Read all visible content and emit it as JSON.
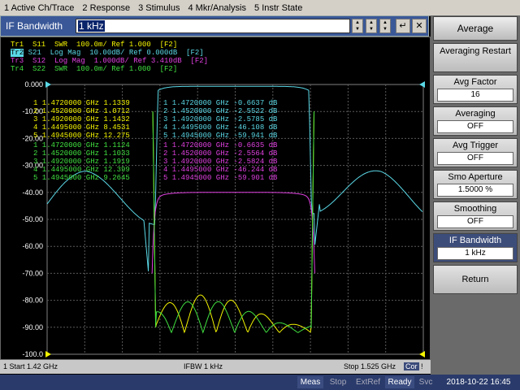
{
  "menu": [
    "1 Active Ch/Trace",
    "2 Response",
    "3 Stimulus",
    "4 Mkr/Analysis",
    "5 Instr State"
  ],
  "entry": {
    "label": "IF Bandwidth",
    "value": "1 kHz"
  },
  "traces": [
    {
      "id": "Tr1",
      "text": "Tr1  S11  SWR  100.0m/ Ref 1.000  [F2]",
      "color": "#f4f400"
    },
    {
      "id": "Tr2",
      "text": "S21  Log Mag  10.00dB/ Ref 0.000dB  [F2]",
      "color": "#5ad8e6"
    },
    {
      "id": "Tr3",
      "text": "Tr3  S12  Log Mag  1.000dB/ Ref 3.410dB  [F2]",
      "color": "#e040e0"
    },
    {
      "id": "Tr4",
      "text": "Tr4  S22  SWR  100.0m/ Ref 1.000  [F2]",
      "color": "#40e040"
    }
  ],
  "yticks": [
    "0.000",
    "-10.00",
    "-20.00",
    "-30.00",
    "-40.00",
    "-50.00",
    "-60.00",
    "-70.00",
    "-80.00",
    "-90.00",
    "-100.0"
  ],
  "marker_tables": {
    "tr1": [
      [
        "1",
        "1.4720000 GHz",
        "1.1339"
      ],
      [
        "2",
        "1.4520000 GHz",
        "1.0712"
      ],
      [
        "3",
        "1.4920000 GHz",
        "1.1432"
      ],
      [
        "4",
        "1.4495000 GHz",
        "8.4531"
      ],
      [
        "5",
        "1.4945000 GHz",
        "12.275"
      ]
    ],
    "tr4": [
      [
        "1",
        "1.4720000 GHz",
        "1.1124"
      ],
      [
        "2",
        "1.4520000 GHz",
        "1.1033"
      ],
      [
        "3",
        "1.4920000 GHz",
        "1.1919"
      ],
      [
        "4",
        "1.4495000 GHz",
        "12.399"
      ],
      [
        "5",
        "1.4945000 GHz",
        "9.2645"
      ]
    ],
    "tr2": [
      [
        "1",
        "1.4720000 GHz",
        "-0.6637 dB"
      ],
      [
        "2",
        "1.4520000 GHz",
        "-2.5522 dB"
      ],
      [
        "3",
        "1.4920000 GHz",
        "-2.5785 dB"
      ],
      [
        "4",
        "1.4495000 GHz",
        "-46.108 dB"
      ],
      [
        "5",
        "1.4945000 GHz",
        "-59.941 dB"
      ]
    ],
    "tr3": [
      [
        "1",
        "1.4720000 GHz",
        "-0.6635 dB"
      ],
      [
        "2",
        "1.4520000 GHz",
        "-2.5564 dB"
      ],
      [
        "3",
        "1.4920000 GHz",
        "-2.5824 dB"
      ],
      [
        "4",
        "1.4495000 GHz",
        "-46.244 dB"
      ],
      [
        "5",
        "1.4945000 GHz",
        "-59.901 dB"
      ]
    ]
  },
  "status": {
    "start": "1  Start 1.42 GHz",
    "ifbw": "IFBW 1 kHz",
    "stop": "Stop 1.525 GHz",
    "cor": "Cor"
  },
  "bottom": {
    "meas": "Meas",
    "stop": "Stop",
    "extref": "ExtRef",
    "ready": "Ready",
    "svc": "Svc",
    "datetime": "2018-10-22 16:45"
  },
  "softkeys": {
    "title": "Average",
    "items": [
      {
        "label": "Averaging Restart",
        "value": ""
      },
      {
        "label": "Avg Factor",
        "value": "16"
      },
      {
        "label": "Averaging",
        "value": "OFF"
      },
      {
        "label": "Avg Trigger",
        "value": "OFF"
      },
      {
        "label": "Smo Aperture",
        "value": "1.5000  %"
      },
      {
        "label": "Smoothing",
        "value": "OFF"
      },
      {
        "label": "IF Bandwidth",
        "value": "1 kHz"
      },
      {
        "label": "Return",
        "value": ""
      }
    ]
  },
  "colors": {
    "tr1": "#f4f400",
    "tr2": "#5ad8e6",
    "tr3": "#e040e0",
    "tr4": "#40e040"
  }
}
